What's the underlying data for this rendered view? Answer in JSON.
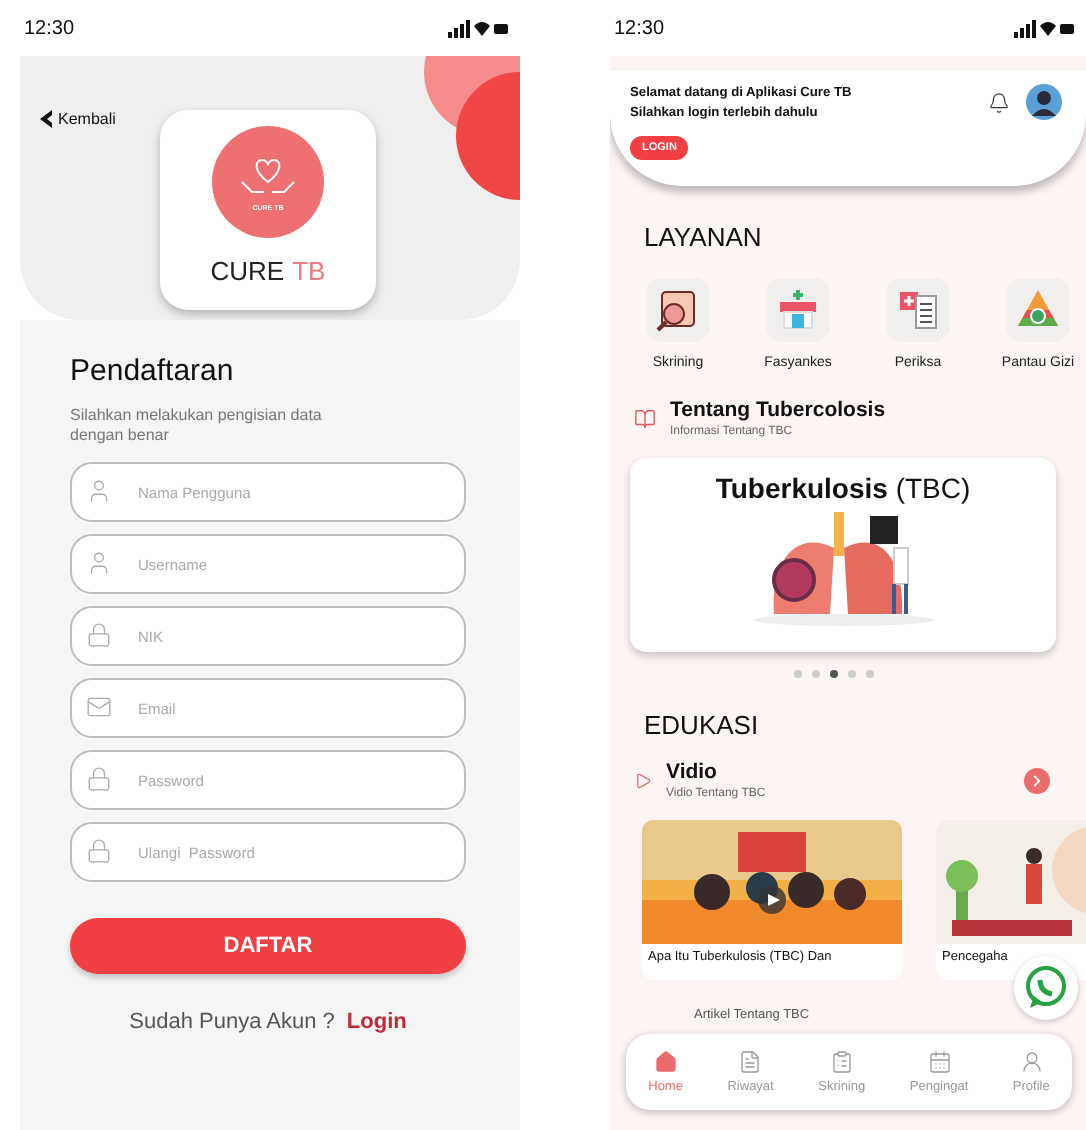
{
  "register": {
    "status_time": "12:30",
    "back_label": "Kembali",
    "logo": {
      "badge": "CURE TB",
      "name_main": "CURE",
      "name_accent": "TB"
    },
    "title": "Pendaftaran",
    "subtitle": "Silahkan melakukan pengisian data dengan benar",
    "fields": [
      {
        "kind": "user",
        "placeholder": "Nama Pengguna"
      },
      {
        "kind": "user",
        "placeholder": "Username"
      },
      {
        "kind": "lock",
        "placeholder": "NIK"
      },
      {
        "kind": "mail",
        "placeholder": "Email"
      },
      {
        "kind": "lock",
        "placeholder": "Password"
      },
      {
        "kind": "lock",
        "placeholder": "Ulangi  Password"
      }
    ],
    "submit": "DAFTAR",
    "login_prompt": "Sudah Punya Akun ?",
    "login_link": "Login"
  },
  "home": {
    "status_time": "12:30",
    "welcome": "Selamat datang di Aplikasi Cure TB",
    "welcome_sub": "Silahkan login terlebih dahulu",
    "login_button": "LOGIN",
    "services_heading": "LAYANAN",
    "services": [
      {
        "kind": "screening",
        "label": "Skrining"
      },
      {
        "kind": "facility",
        "label": "Fasyankes"
      },
      {
        "kind": "checkup",
        "label": "Periksa"
      },
      {
        "kind": "nutrition",
        "label": "Pantau Gizi"
      }
    ],
    "about": {
      "title": "Tentang Tubercolosis",
      "subtitle": "Informasi Tentang TBC"
    },
    "banner_title": "**Tuberkulosis** (TBC)",
    "dots": [
      {
        "selected": false
      },
      {
        "selected": false
      },
      {
        "selected": true
      },
      {
        "selected": false
      },
      {
        "selected": false
      }
    ],
    "education_heading": "EDUKASI",
    "video_section": {
      "title": "Vidio",
      "subtitle": "Vidio Tentang TBC"
    },
    "videos": [
      {
        "kind": "picture",
        "caption": "Apa Itu Tuberkulosis (TBC) Dan"
      },
      {
        "kind": "picture",
        "caption": "Pencegaha"
      }
    ],
    "article_subtitle": "Artikel Tentang TBC",
    "nav": [
      {
        "kind": "home",
        "label": "Home",
        "selected": true
      },
      {
        "kind": "history",
        "label": "Riwayat",
        "selected": false
      },
      {
        "kind": "screening",
        "label": "Skrining",
        "selected": false
      },
      {
        "kind": "reminder",
        "label": "Pengingat",
        "selected": false
      },
      {
        "kind": "profile",
        "label": "Profile",
        "selected": false
      }
    ]
  }
}
